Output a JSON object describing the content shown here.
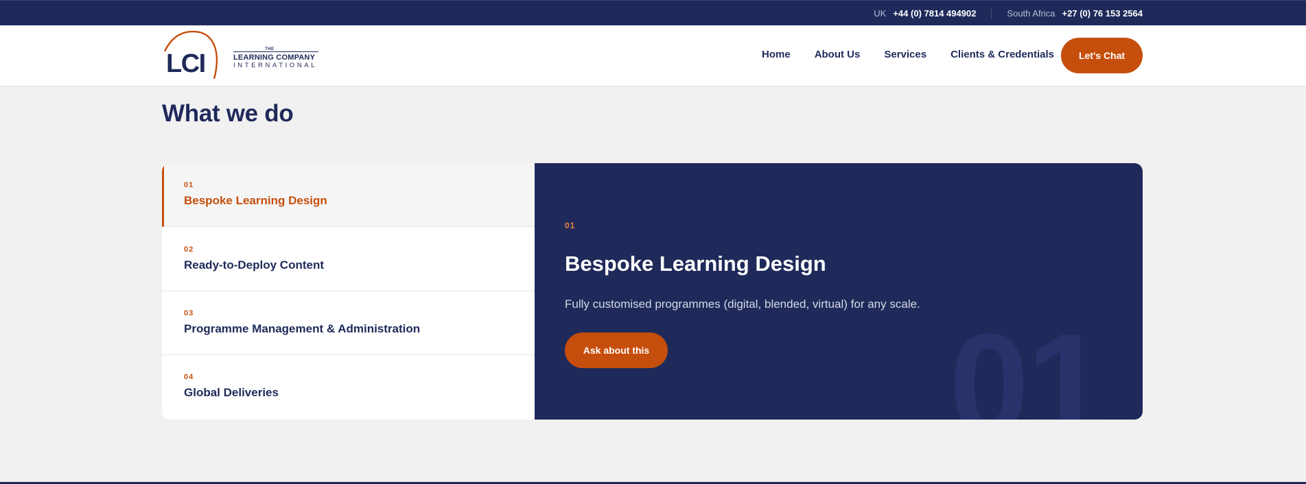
{
  "topbar": {
    "uk_label": "UK",
    "uk_phone": "+44 (0) 7814 494902",
    "sa_label": "South Africa",
    "sa_phone": "+27 (0) 76 153 2564"
  },
  "logo": {
    "mark": "LCI",
    "small": "THE",
    "line1": "LEARNING COMPANY",
    "line2": "INTERNATIONAL"
  },
  "nav": {
    "items": [
      "Home",
      "About Us",
      "Services",
      "Clients & Credentials"
    ],
    "cta": "Let's Chat"
  },
  "section": {
    "title": "What we do"
  },
  "tabs": [
    {
      "num": "01",
      "label": "Bespoke Learning Design"
    },
    {
      "num": "02",
      "label": "Ready-to-Deploy Content"
    },
    {
      "num": "03",
      "label": "Programme Management & Administration"
    },
    {
      "num": "04",
      "label": "Global Deliveries"
    }
  ],
  "panel": {
    "num": "01",
    "title": "Bespoke Learning Design",
    "description": "Fully customised programmes (digital, blended, virtual) for any scale.",
    "button": "Ask about this",
    "watermark": "01"
  },
  "colors": {
    "navy": "#1f2a5a",
    "accent": "#c64e0c",
    "background": "#f1f1f1"
  }
}
